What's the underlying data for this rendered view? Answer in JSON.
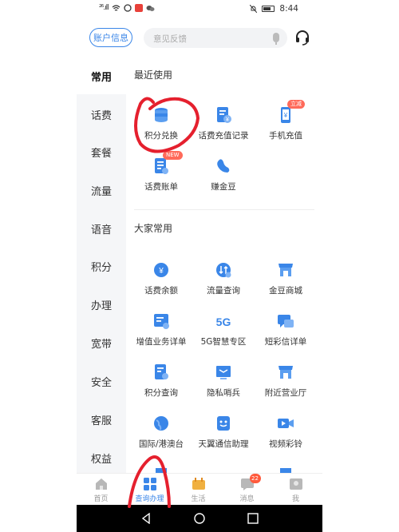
{
  "status_bar": {
    "signal": "²⁶.ıll",
    "time": "8:44",
    "icons": [
      "wifi-icon",
      "app-icon-red",
      "app-icon-orange",
      "wechat-icon",
      "mute-icon",
      "battery-icon"
    ]
  },
  "header": {
    "account_label": "账户信息",
    "search_placeholder": "意见反馈",
    "icons": [
      "mic-icon",
      "headset-icon"
    ]
  },
  "sidebar": {
    "items": [
      {
        "label": "常用",
        "active": true
      },
      {
        "label": "话费"
      },
      {
        "label": "套餐"
      },
      {
        "label": "流量"
      },
      {
        "label": "语音"
      },
      {
        "label": "积分"
      },
      {
        "label": "办理"
      },
      {
        "label": "宽带"
      },
      {
        "label": "安全"
      },
      {
        "label": "客服"
      },
      {
        "label": "权益"
      }
    ]
  },
  "recent": {
    "title": "最近使用",
    "items": [
      {
        "label": "积分兑换",
        "icon": "coin-stack-icon"
      },
      {
        "label": "话费充值记录",
        "icon": "recharge-record-icon"
      },
      {
        "label": "手机充值",
        "icon": "phone-recharge-icon",
        "badge": "立减"
      },
      {
        "label": "话费账单",
        "icon": "bill-icon",
        "badge": "NEW"
      },
      {
        "label": "赚金豆",
        "icon": "bean-icon"
      }
    ]
  },
  "popular": {
    "title": "大家常用",
    "items": [
      {
        "label": "话费余额",
        "icon": "yuan-coin-icon"
      },
      {
        "label": "流量查询",
        "icon": "data-query-icon"
      },
      {
        "label": "金豆商城",
        "icon": "store-icon"
      },
      {
        "label": "增值业务详单",
        "icon": "service-detail-icon"
      },
      {
        "label": "5G智慧专区",
        "icon": "5g-icon",
        "icon_text": "5G"
      },
      {
        "label": "短彩信详单",
        "icon": "sms-detail-icon"
      },
      {
        "label": "积分查询",
        "icon": "points-query-icon"
      },
      {
        "label": "隐私哨兵",
        "icon": "privacy-icon"
      },
      {
        "label": "附近营业厅",
        "icon": "nearby-store-icon"
      },
      {
        "label": "国际/港澳台",
        "icon": "globe-icon"
      },
      {
        "label": "天翼通信助理",
        "icon": "assistant-icon"
      },
      {
        "label": "视频彩铃",
        "icon": "video-ringtone-icon"
      }
    ]
  },
  "tabbar": {
    "items": [
      {
        "label": "首页",
        "icon": "home-icon"
      },
      {
        "label": "查询办理",
        "icon": "grid-icon",
        "active": true
      },
      {
        "label": "生活",
        "icon": "life-icon"
      },
      {
        "label": "消息",
        "icon": "message-icon",
        "badge": "22"
      },
      {
        "label": "我",
        "icon": "profile-icon"
      }
    ]
  },
  "colors": {
    "accent": "#3a86e8",
    "annotation": "#e5202e",
    "badge": "#ff6a5a"
  }
}
